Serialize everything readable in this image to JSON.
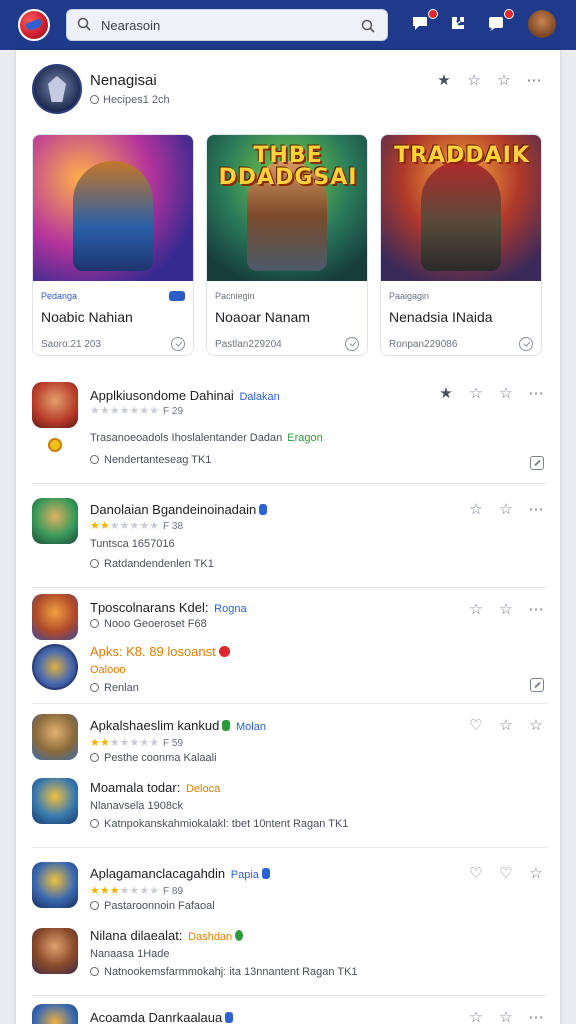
{
  "header": {
    "search_text": "Nearasoin"
  },
  "developer": {
    "name": "Nenagisai",
    "subtitle": "Hecipes1 2ch"
  },
  "featured": [
    {
      "dev": "Pedanga",
      "title": "Noabic Nahian",
      "footer": "Saoro:21 203",
      "art_title": ""
    },
    {
      "dev": "Pacniegin",
      "title": "Noaoar Nanam",
      "footer": "Pastlan229204",
      "art_title": "THBE DDADGSAI"
    },
    {
      "dev": "Paaigagin",
      "title": "Nenadsia INaida",
      "footer": "Ronpan229086",
      "art_title": "TRADDAIK"
    }
  ],
  "apps": [
    {
      "title": "Applkiusondome Dahinai",
      "tag": "Dalakan",
      "rating_count": "F 29",
      "desc": "Trasanoeoadols Ihoslalentander Dadan",
      "desc_tag": "Eragon",
      "meta": "Nendertanteseag TK1"
    },
    {
      "title": "Danolaian Bgandeinoinadain",
      "rating_count": "F 38",
      "desc": "Tuntsca 1657016",
      "meta": "Ratdandendenlen TK1"
    },
    {
      "title": "Tposcolnarans Kdel:",
      "tag": "Rogna",
      "desc": "Nooo Geoeroset F68",
      "sub_title": "Apks: K8. 89 losoanst",
      "sub_tag": "Oalooo",
      "meta": "Renlan"
    },
    {
      "title": "Apkalshaeslim kankud",
      "tag": "Molan",
      "rating_count": "F 59",
      "desc": "Pesthe coonma Kalaali",
      "sub_title": "Moamala todar:",
      "sub_tag": "Deloca",
      "sub_desc": "Nlanavsela 1908ck",
      "meta": "Katnpokanskahmiokalakl: tbet 10ntent Ragan TK1"
    },
    {
      "title": "Aplagamanclacagahdin",
      "tag": "Papia",
      "rating_count": "F 89",
      "desc": "Pastaroonnoin Fafaoal",
      "sub_title": "Nilana dilaealat:",
      "sub_tag": "Dashdan",
      "sub_desc": "Nanaasa 1Hade",
      "meta": "Natnookemsfarmmokahj: ita 13nnantent Ragan TK1"
    },
    {
      "title": "Acoamda Danrkaalaua"
    }
  ],
  "colors": {
    "topbar": "#1f3a8a",
    "accent_blue": "#2b62d6",
    "accent_green": "#2c9c3a",
    "star": "#f0b400"
  }
}
